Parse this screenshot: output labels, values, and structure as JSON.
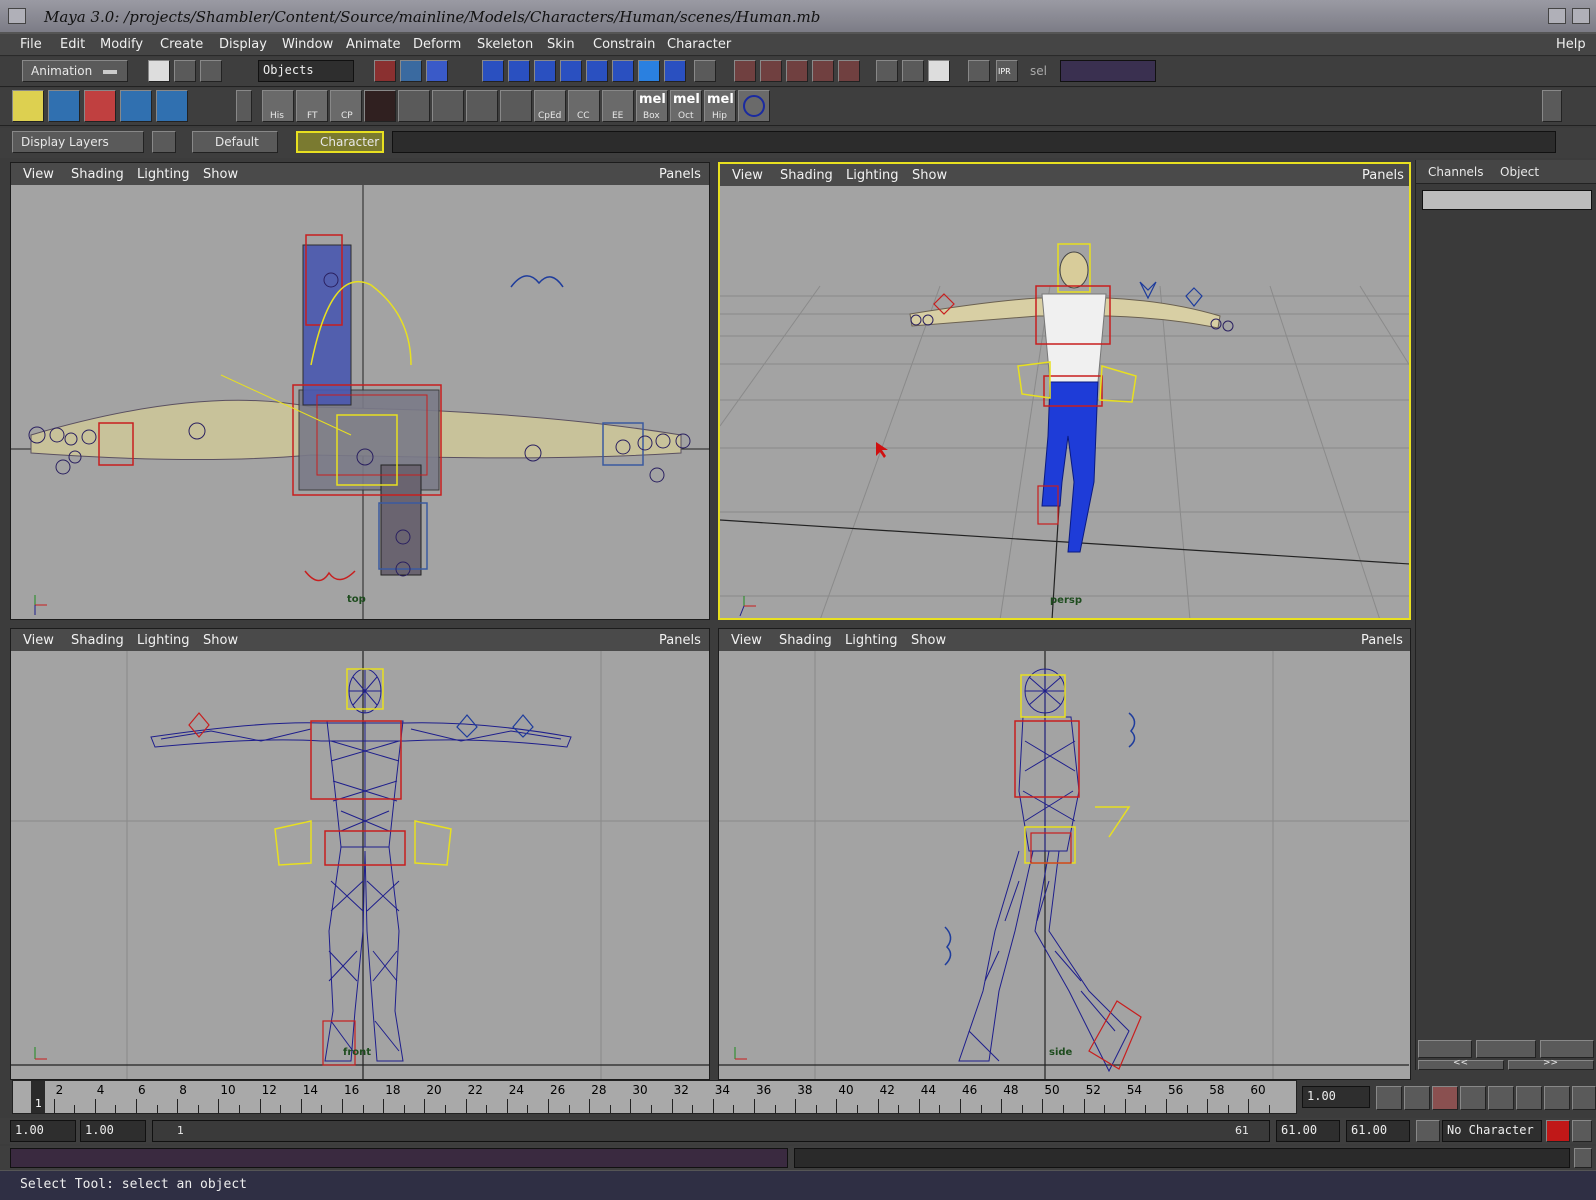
{
  "window": {
    "title": "Maya 3.0: /projects/Shambler/Content/Source/mainline/Models/Characters/Human/scenes/Human.mb"
  },
  "menu": {
    "items": [
      "File",
      "Edit",
      "Modify",
      "Create",
      "Display",
      "Window",
      "Animate",
      "Deform",
      "Skeleton",
      "Skin",
      "Constrain",
      "Character"
    ],
    "help": "Help"
  },
  "status_line": {
    "mode": "Animation",
    "selection_mask": "Objects",
    "sel_label": "sel",
    "ipr_label": "IPR"
  },
  "shelf": {
    "labels": [
      "His",
      "FT",
      "CP",
      "",
      "",
      "",
      "",
      "",
      "CpEd",
      "CC",
      "EE",
      "Box",
      "Oct",
      "Hip"
    ],
    "mel": "mel"
  },
  "layer_bar": {
    "display_layers": "Display Layers",
    "default_layer": "Default",
    "character_layer": "Character"
  },
  "panels": {
    "menu": [
      "View",
      "Shading",
      "Lighting",
      "Show"
    ],
    "panels_label": "Panels",
    "top_cam": "top",
    "persp_cam": "persp",
    "front_cam": "front",
    "side_cam": "side"
  },
  "channel_box": {
    "tabs": [
      "Channels",
      "Object"
    ],
    "prev": "<<",
    "next": ">>"
  },
  "time_slider": {
    "ticks": [
      "2",
      "4",
      "6",
      "8",
      "10",
      "12",
      "14",
      "16",
      "18",
      "20",
      "22",
      "24",
      "26",
      "28",
      "30",
      "32",
      "34",
      "36",
      "38",
      "40",
      "42",
      "44",
      "46",
      "48",
      "50",
      "52",
      "54",
      "56",
      "58",
      "60"
    ],
    "current_frame": "1",
    "current_time": "1.00"
  },
  "range_slider": {
    "start": "1.00",
    "anim_start": "1.00",
    "range_start": "1",
    "range_end": "61",
    "playback_end": "61.00",
    "anim_end": "61.00",
    "character": "No Character"
  },
  "help_line": {
    "text": "Select Tool: select an object"
  },
  "colors": {
    "viewport_bg": "#a3a3a3",
    "active_border": "#e8e020",
    "wire": "#1e1e8c",
    "control_red": "#c81e1e",
    "control_yellow": "#e8e020"
  }
}
